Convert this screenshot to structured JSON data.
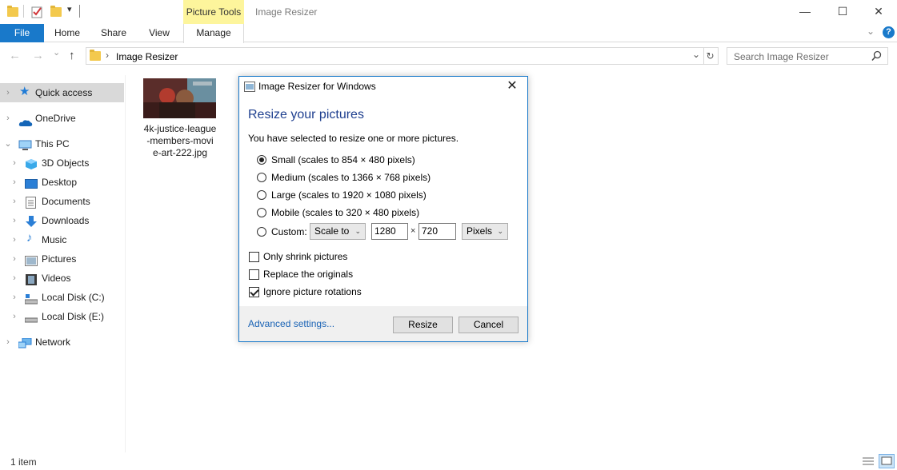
{
  "titlebar": {
    "contextual_tab": "Picture Tools",
    "window_title": "Image Resizer",
    "minimize": "—",
    "maximize": "☐",
    "close": "✕"
  },
  "ribbon": {
    "tabs": [
      "File",
      "Home",
      "Share",
      "View",
      "Manage"
    ],
    "expand_icon": "chevron-down-icon",
    "help": "?"
  },
  "address": {
    "back": "←",
    "forward": "→",
    "recent": "⌄",
    "up": "↑",
    "separator": "›",
    "path": "Image Resizer",
    "dropdown": "⌄",
    "refresh": "↻",
    "search_placeholder": "Search Image Resizer"
  },
  "nav": {
    "items": [
      {
        "label": "Quick access"
      },
      {
        "label": "OneDrive"
      },
      {
        "label": "This PC"
      },
      {
        "label": "3D Objects"
      },
      {
        "label": "Desktop"
      },
      {
        "label": "Documents"
      },
      {
        "label": "Downloads"
      },
      {
        "label": "Music"
      },
      {
        "label": "Pictures"
      },
      {
        "label": "Videos"
      },
      {
        "label": "Local Disk (C:)"
      },
      {
        "label": "Local Disk (E:)"
      },
      {
        "label": "Network"
      }
    ]
  },
  "files": [
    {
      "name": "4k-justice-league-members-movie-art-222.jpg",
      "line1": "4k-justice-league",
      "line2": "-members-movi",
      "line3": "e-art-222.jpg"
    }
  ],
  "status": {
    "text": "1 item"
  },
  "dialog": {
    "title": "Image Resizer for Windows",
    "close": "✕",
    "heading": "Resize your pictures",
    "description": "You have selected to resize one or more pictures.",
    "sizes": [
      {
        "label": "Small (scales to 854 × 480 pixels)",
        "selected": true
      },
      {
        "label": "Medium (scales to 1366 × 768 pixels)",
        "selected": false
      },
      {
        "label": "Large (scales to 1920 × 1080 pixels)",
        "selected": false
      },
      {
        "label": "Mobile (scales to 320 × 480 pixels)",
        "selected": false
      }
    ],
    "custom": {
      "label": "Custom:",
      "mode": "Scale to",
      "width": "1280",
      "times": "×",
      "height": "720",
      "unit": "Pixels",
      "arrow": "⌄"
    },
    "options": [
      {
        "label": "Only shrink pictures",
        "checked": false
      },
      {
        "label": "Replace the originals",
        "checked": false
      },
      {
        "label": "Ignore picture rotations",
        "checked": true
      }
    ],
    "advanced_link": "Advanced settings...",
    "resize_button": "Resize",
    "cancel_button": "Cancel"
  },
  "colors": {
    "accent": "#1979ca",
    "contextual_tab": "#fdf59c",
    "heading": "#1e3f8f",
    "link": "#1a63b5"
  }
}
